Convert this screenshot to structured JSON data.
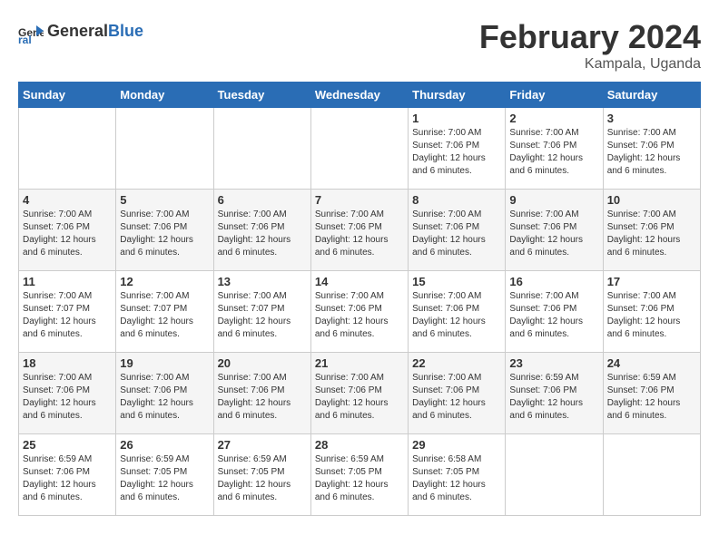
{
  "logo": {
    "text_general": "General",
    "text_blue": "Blue"
  },
  "title": "February 2024",
  "subtitle": "Kampala, Uganda",
  "days_of_week": [
    "Sunday",
    "Monday",
    "Tuesday",
    "Wednesday",
    "Thursday",
    "Friday",
    "Saturday"
  ],
  "weeks": [
    {
      "shaded": false,
      "days": [
        {
          "number": "",
          "info": ""
        },
        {
          "number": "",
          "info": ""
        },
        {
          "number": "",
          "info": ""
        },
        {
          "number": "",
          "info": ""
        },
        {
          "number": "1",
          "info": "Sunrise: 7:00 AM\nSunset: 7:06 PM\nDaylight: 12 hours\nand 6 minutes."
        },
        {
          "number": "2",
          "info": "Sunrise: 7:00 AM\nSunset: 7:06 PM\nDaylight: 12 hours\nand 6 minutes."
        },
        {
          "number": "3",
          "info": "Sunrise: 7:00 AM\nSunset: 7:06 PM\nDaylight: 12 hours\nand 6 minutes."
        }
      ]
    },
    {
      "shaded": true,
      "days": [
        {
          "number": "4",
          "info": "Sunrise: 7:00 AM\nSunset: 7:06 PM\nDaylight: 12 hours\nand 6 minutes."
        },
        {
          "number": "5",
          "info": "Sunrise: 7:00 AM\nSunset: 7:06 PM\nDaylight: 12 hours\nand 6 minutes."
        },
        {
          "number": "6",
          "info": "Sunrise: 7:00 AM\nSunset: 7:06 PM\nDaylight: 12 hours\nand 6 minutes."
        },
        {
          "number": "7",
          "info": "Sunrise: 7:00 AM\nSunset: 7:06 PM\nDaylight: 12 hours\nand 6 minutes."
        },
        {
          "number": "8",
          "info": "Sunrise: 7:00 AM\nSunset: 7:06 PM\nDaylight: 12 hours\nand 6 minutes."
        },
        {
          "number": "9",
          "info": "Sunrise: 7:00 AM\nSunset: 7:06 PM\nDaylight: 12 hours\nand 6 minutes."
        },
        {
          "number": "10",
          "info": "Sunrise: 7:00 AM\nSunset: 7:06 PM\nDaylight: 12 hours\nand 6 minutes."
        }
      ]
    },
    {
      "shaded": false,
      "days": [
        {
          "number": "11",
          "info": "Sunrise: 7:00 AM\nSunset: 7:07 PM\nDaylight: 12 hours\nand 6 minutes."
        },
        {
          "number": "12",
          "info": "Sunrise: 7:00 AM\nSunset: 7:07 PM\nDaylight: 12 hours\nand 6 minutes."
        },
        {
          "number": "13",
          "info": "Sunrise: 7:00 AM\nSunset: 7:07 PM\nDaylight: 12 hours\nand 6 minutes."
        },
        {
          "number": "14",
          "info": "Sunrise: 7:00 AM\nSunset: 7:06 PM\nDaylight: 12 hours\nand 6 minutes."
        },
        {
          "number": "15",
          "info": "Sunrise: 7:00 AM\nSunset: 7:06 PM\nDaylight: 12 hours\nand 6 minutes."
        },
        {
          "number": "16",
          "info": "Sunrise: 7:00 AM\nSunset: 7:06 PM\nDaylight: 12 hours\nand 6 minutes."
        },
        {
          "number": "17",
          "info": "Sunrise: 7:00 AM\nSunset: 7:06 PM\nDaylight: 12 hours\nand 6 minutes."
        }
      ]
    },
    {
      "shaded": true,
      "days": [
        {
          "number": "18",
          "info": "Sunrise: 7:00 AM\nSunset: 7:06 PM\nDaylight: 12 hours\nand 6 minutes."
        },
        {
          "number": "19",
          "info": "Sunrise: 7:00 AM\nSunset: 7:06 PM\nDaylight: 12 hours\nand 6 minutes."
        },
        {
          "number": "20",
          "info": "Sunrise: 7:00 AM\nSunset: 7:06 PM\nDaylight: 12 hours\nand 6 minutes."
        },
        {
          "number": "21",
          "info": "Sunrise: 7:00 AM\nSunset: 7:06 PM\nDaylight: 12 hours\nand 6 minutes."
        },
        {
          "number": "22",
          "info": "Sunrise: 7:00 AM\nSunset: 7:06 PM\nDaylight: 12 hours\nand 6 minutes."
        },
        {
          "number": "23",
          "info": "Sunrise: 6:59 AM\nSunset: 7:06 PM\nDaylight: 12 hours\nand 6 minutes."
        },
        {
          "number": "24",
          "info": "Sunrise: 6:59 AM\nSunset: 7:06 PM\nDaylight: 12 hours\nand 6 minutes."
        }
      ]
    },
    {
      "shaded": false,
      "days": [
        {
          "number": "25",
          "info": "Sunrise: 6:59 AM\nSunset: 7:06 PM\nDaylight: 12 hours\nand 6 minutes."
        },
        {
          "number": "26",
          "info": "Sunrise: 6:59 AM\nSunset: 7:05 PM\nDaylight: 12 hours\nand 6 minutes."
        },
        {
          "number": "27",
          "info": "Sunrise: 6:59 AM\nSunset: 7:05 PM\nDaylight: 12 hours\nand 6 minutes."
        },
        {
          "number": "28",
          "info": "Sunrise: 6:59 AM\nSunset: 7:05 PM\nDaylight: 12 hours\nand 6 minutes."
        },
        {
          "number": "29",
          "info": "Sunrise: 6:58 AM\nSunset: 7:05 PM\nDaylight: 12 hours\nand 6 minutes."
        },
        {
          "number": "",
          "info": ""
        },
        {
          "number": "",
          "info": ""
        }
      ]
    }
  ]
}
